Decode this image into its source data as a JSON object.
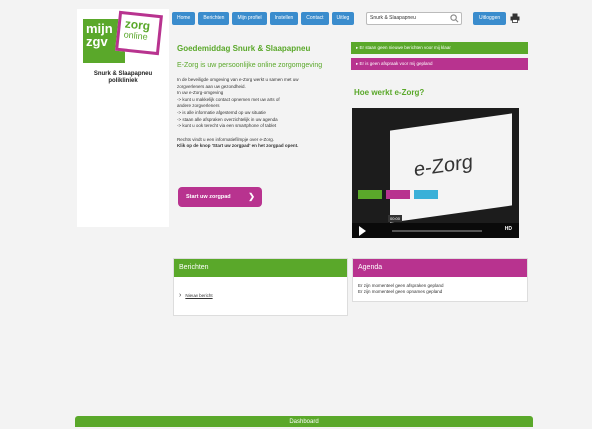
{
  "logo": {
    "line1": "mijn",
    "line2": "zgv",
    "zorg": "zorg",
    "online": "online"
  },
  "clinic": {
    "name_line1": "Snurk & Slaapapneu",
    "name_line2": "polikliniek"
  },
  "nav": {
    "items": [
      "Home",
      "Berichten",
      "Mijn profiel",
      "Instellen",
      "Contact",
      "Uitleg"
    ]
  },
  "search": {
    "value": "Snurk & Slaapapneu"
  },
  "header": {
    "logout_label": "Uitloggen"
  },
  "main": {
    "greeting": "Goedemiddag Snurk & Slaapapneu",
    "tagline": "E-Zorg is uw persoonlijke online zorgomgeving",
    "intro": [
      "In de beveiligde omgeving van e-Zorg werkt u samen met uw",
      "zorgverleners aan uw gezondheid.",
      "In uw e-Zorg-omgeving",
      "-> kunt u makkelijk contact opnemen met uw arts of",
      "andere zorgverleners",
      "-> is alle informatie afgestemd op uw situatie",
      "-> staan alle afspraken overzichtelijk in uw agenda",
      "-> kunt u ook terecht via een smartphone of tablet"
    ],
    "video_note": "Rechts vindt u een informatiefilmpje over e-Zorg.",
    "cta_note": "Klik op de knop 'Start uw zorgpad' en het zorgpad opent.",
    "start_button": "Start uw zorgpad"
  },
  "alerts": {
    "no_messages": "Er staan geen nieuwe berichten voor mij klaar",
    "no_appointments": "Er is geen afspraak voor mij gepland"
  },
  "video": {
    "title": "Hoe werkt e-Zorg?",
    "screen_text": "e-Zorg",
    "time": "00:00",
    "hd": "HD",
    "progress": 0.0
  },
  "messages": {
    "title": "Berichten",
    "new_message": "Nieuw bericht"
  },
  "agenda": {
    "title": "Agenda",
    "lines": [
      "Er zijn momenteel geen afspraken gepland",
      "Er zijn momenteel geen opnames gepland"
    ]
  },
  "footer": {
    "dashboard": "Dashboard"
  },
  "colors": {
    "green": "#5aa82a",
    "pink": "#b8338f",
    "blue": "#3a8ccd"
  }
}
